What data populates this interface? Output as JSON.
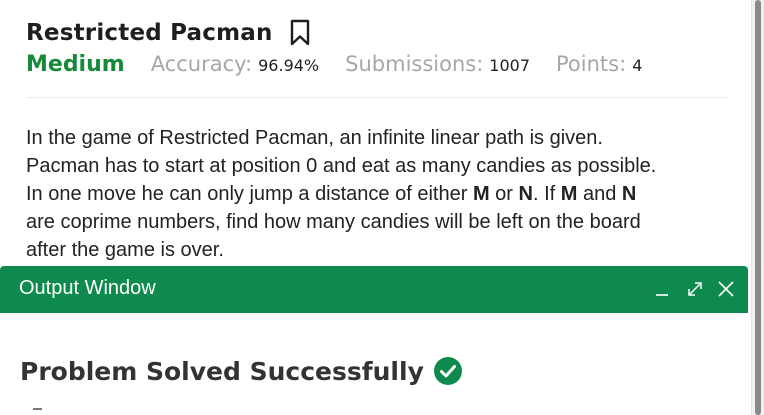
{
  "problem": {
    "title": "Restricted Pacman",
    "difficulty": "Medium",
    "accuracy_label": "Accuracy:",
    "accuracy_value": "96.94%",
    "submissions_label": "Submissions:",
    "submissions_value": "1007",
    "points_label": "Points:",
    "points_value": "4",
    "description": {
      "line1": "In the game of Restricted Pacman, an infinite linear path is given.",
      "line2": "Pacman has to start at position 0 and eat as many candies as possible.",
      "line3_a": "In one move he can only jump a distance of either ",
      "line3_m": "M",
      "line3_or": " or ",
      "line3_n": "N",
      "line3_b": ".  If ",
      "line3_m2": "M",
      "line3_and": " and ",
      "line3_n2": "N",
      "line4": "are coprime numbers, find how many candies will be left on the board",
      "line5": "after the game is over."
    }
  },
  "output_window": {
    "title": "Output Window",
    "result": "Problem Solved Successfully"
  },
  "icons": {
    "bookmark": "bookmark-icon",
    "minimize": "minimize-icon",
    "maximize": "maximize-icon",
    "close": "close-icon",
    "check": "check-circle-icon"
  },
  "colors": {
    "accent_green": "#0f8a4f",
    "difficulty_green": "#178a3a",
    "muted_gray": "#a7a7a7"
  }
}
